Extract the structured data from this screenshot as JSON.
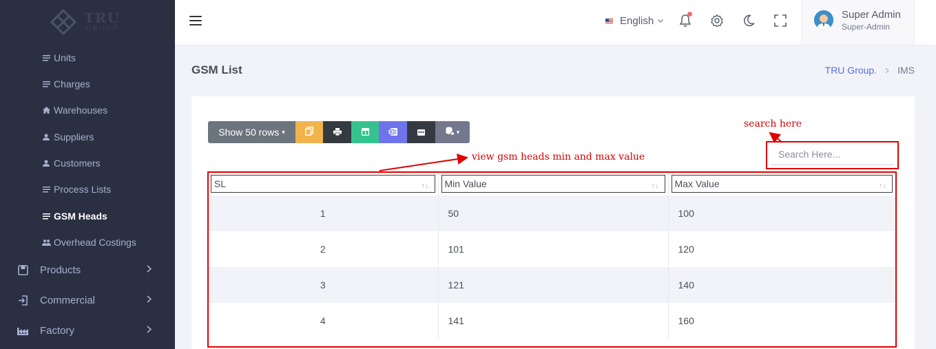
{
  "sidebar": {
    "logo_text": "TRU",
    "logo_sub": "GROUP",
    "sub_items": [
      {
        "label": "Units",
        "icon": "list-icon"
      },
      {
        "label": "Charges",
        "icon": "list-icon"
      },
      {
        "label": "Warehouses",
        "icon": "home-icon"
      },
      {
        "label": "Suppliers",
        "icon": "user-icon"
      },
      {
        "label": "Customers",
        "icon": "user-icon"
      },
      {
        "label": "Process Lists",
        "icon": "list-icon"
      },
      {
        "label": "GSM Heads",
        "icon": "list-icon",
        "active": true
      },
      {
        "label": "Overhead Costings",
        "icon": "users-icon"
      }
    ],
    "main_items": [
      {
        "label": "Products",
        "icon": "box-icon"
      },
      {
        "label": "Commercial",
        "icon": "sign-in-icon"
      },
      {
        "label": "Factory",
        "icon": "factory-icon"
      }
    ]
  },
  "header": {
    "language": "English",
    "user_name": "Super Admin",
    "user_role": "Super-Admin"
  },
  "page": {
    "title": "GSM List",
    "breadcrumb": [
      "TRU Group.",
      "IMS"
    ]
  },
  "toolbar": {
    "show_rows_label": "Show 50 rows"
  },
  "search": {
    "placeholder": "Search Here..."
  },
  "table": {
    "columns": [
      "SL",
      "Min Value",
      "Max Value"
    ],
    "rows": [
      [
        "1",
        "50",
        "100"
      ],
      [
        "2",
        "101",
        "120"
      ],
      [
        "3",
        "121",
        "140"
      ],
      [
        "4",
        "141",
        "160"
      ]
    ]
  },
  "annotations": {
    "search_note": "search here",
    "table_note": "view gsm heads min and max value"
  },
  "colors": {
    "sidebar_bg": "#2a3042",
    "annotation": "#e00000",
    "accent": "#556ee6"
  }
}
